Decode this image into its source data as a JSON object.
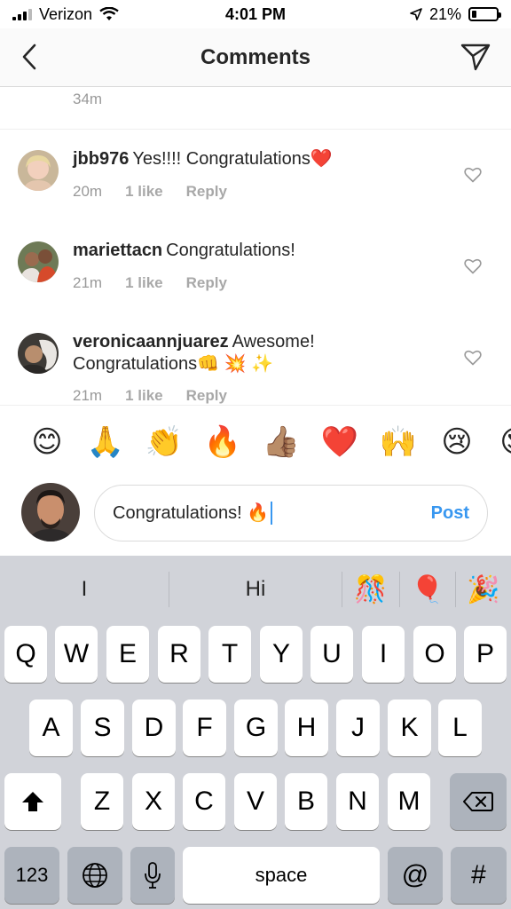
{
  "status_bar": {
    "carrier": "Verizon",
    "time": "4:01 PM",
    "battery": "21%",
    "battery_level": 0.21
  },
  "header": {
    "title": "Comments",
    "back_icon": "chevron-left-icon",
    "send_icon": "paper-plane-icon"
  },
  "comments": {
    "previous_time": "34m",
    "items": [
      {
        "user": "jbb976",
        "text": "Yes!!!! Congratulations❤️",
        "time": "20m",
        "likes": "1 like",
        "reply": "Reply"
      },
      {
        "user": "mariettacn",
        "text": "Congratulations!",
        "time": "21m",
        "likes": "1 like",
        "reply": "Reply"
      },
      {
        "user": "veronicaannjuarez",
        "text": "Awesome! Congratulations👊 💥 ✨",
        "time": "21m",
        "likes": "1 like",
        "reply": "Reply"
      }
    ]
  },
  "emoji_bar": [
    "😊",
    "🙏",
    "👏",
    "🔥",
    "👍🏽",
    "❤️",
    "🙌",
    "😢",
    "😍"
  ],
  "composer": {
    "value": "Congratulations! 🔥",
    "post_label": "Post"
  },
  "keyboard": {
    "suggestions": [
      "I",
      "Hi",
      "🎊",
      "🎈",
      "🎉"
    ],
    "row1": [
      "Q",
      "W",
      "E",
      "R",
      "T",
      "Y",
      "U",
      "I",
      "O",
      "P"
    ],
    "row2": [
      "A",
      "S",
      "D",
      "F",
      "G",
      "H",
      "J",
      "K",
      "L"
    ],
    "row3": [
      "Z",
      "X",
      "C",
      "V",
      "B",
      "N",
      "M"
    ],
    "numbers_label": "123",
    "space_label": "space",
    "at_label": "@",
    "hash_label": "#"
  },
  "colors": {
    "accent": "#3897f0",
    "heart": "#ed4956",
    "keyboard_bg": "#d1d3d9"
  }
}
